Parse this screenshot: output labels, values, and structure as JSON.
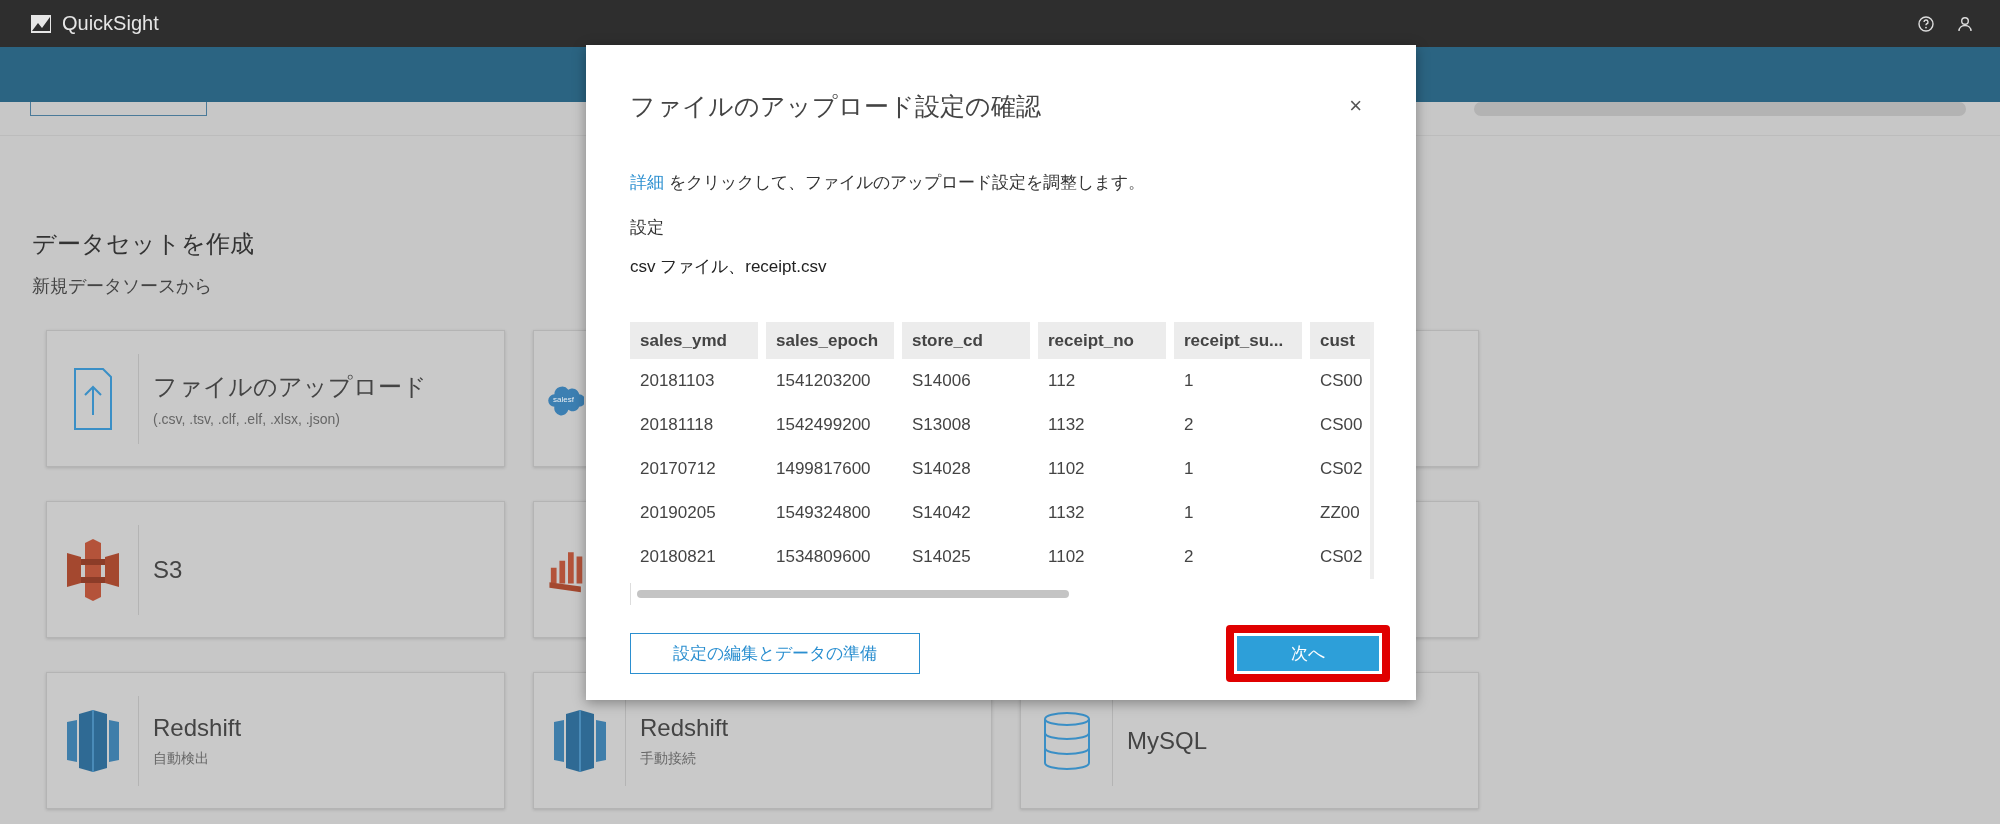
{
  "app": {
    "name": "QuickSight"
  },
  "page": {
    "heading": "データセットを作成",
    "subheading": "新規データソースから"
  },
  "sources": [
    {
      "kind": "upload",
      "title": "ファイルのアップロード",
      "subtitle": "(.csv, .tsv, .clf, .elf, .xlsx, .json)"
    },
    {
      "kind": "salesforce",
      "logo_text": "salesf"
    },
    {
      "kind": "blank"
    },
    {
      "kind": "s3",
      "title": "S3"
    },
    {
      "kind": "athena"
    },
    {
      "kind": "blank"
    },
    {
      "kind": "redshift",
      "title": "Redshift",
      "subtitle": "自動検出"
    },
    {
      "kind": "redshift",
      "title": "Redshift",
      "subtitle": "手動接続"
    },
    {
      "kind": "database",
      "title": "MySQL"
    }
  ],
  "dialog": {
    "title": "ファイルのアップロード設定の確認",
    "close": "×",
    "intro_link": "詳細",
    "intro_text": " をクリックして、ファイルのアップロード設定を調整します。",
    "settings_label": "設定",
    "settings_value": "csv ファイル、receipt.csv",
    "table": {
      "columns": [
        "sales_ymd",
        "sales_epoch",
        "store_cd",
        "receipt_no",
        "receipt_su...",
        "cust"
      ],
      "rows": [
        [
          "20181103",
          "1541203200",
          "S14006",
          "112",
          "1",
          "CS00"
        ],
        [
          "20181118",
          "1542499200",
          "S13008",
          "1132",
          "2",
          "CS00"
        ],
        [
          "20170712",
          "1499817600",
          "S14028",
          "1102",
          "1",
          "CS02"
        ],
        [
          "20190205",
          "1549324800",
          "S14042",
          "1132",
          "1",
          "ZZ00"
        ],
        [
          "20180821",
          "1534809600",
          "S14025",
          "1102",
          "2",
          "CS02"
        ]
      ]
    },
    "buttons": [
      {
        "label": "設定の編集とデータの準備",
        "kind": "secondary",
        "highlighted": false
      },
      {
        "label": "次へ",
        "kind": "primary",
        "highlighted": true
      }
    ]
  }
}
